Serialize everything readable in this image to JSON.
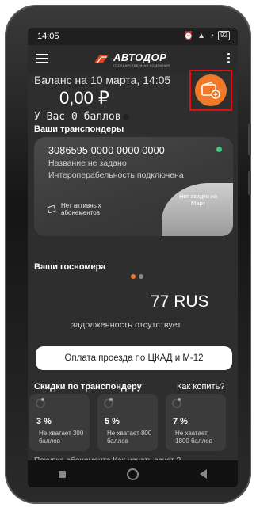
{
  "status": {
    "time": "14:05",
    "battery": "92"
  },
  "app": {
    "logo_name": "АВТОДОР",
    "logo_sub": "ГОСУДАРСТВЕННАЯ КОМПАНИЯ"
  },
  "balance": {
    "date_label": "Баланс на 10 марта, 14:05",
    "amount": "0,00 ₽",
    "points_label": "У Вас   0 баллов"
  },
  "transponders": {
    "title": "Ваши транспондеры",
    "card": {
      "number": "3086595 0000 0000 0000",
      "name": "Название не задано",
      "interop": "Интероперабельность подключена",
      "subscriptions": "Нет активных абонементов",
      "discount": "Нет скидки на Март"
    }
  },
  "plates": {
    "title": "Ваши госномера",
    "plate": "77 RUS",
    "debt": "задолженность отсутствует"
  },
  "pay_button": "Оплата проезда по ЦКАД и М-12",
  "discounts": {
    "title": "Скидки по транспондеру",
    "how_link": "Как копить?",
    "items": [
      {
        "pct": "3 %",
        "need": "Не хватает 300 баллов"
      },
      {
        "pct": "5 %",
        "need": "Не хватает 800 баллов"
      },
      {
        "pct": "7 %",
        "need": "Не хватает 1800 баллов"
      }
    ]
  },
  "bottom_cut": "Покупка абонемента        Как начать зачет ?",
  "colors": {
    "accent": "#f07a2a",
    "highlight": "#e01010",
    "status_ok": "#3ecb7a"
  }
}
